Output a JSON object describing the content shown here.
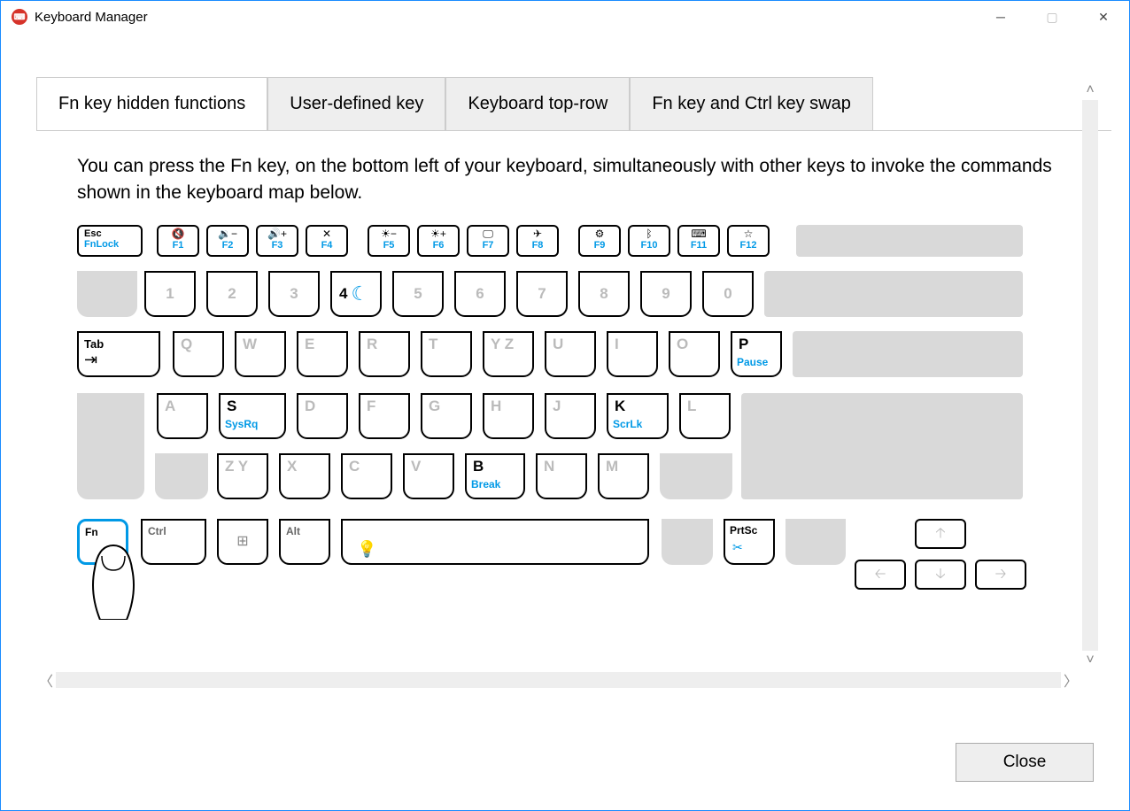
{
  "window": {
    "title": "Keyboard Manager"
  },
  "tabs": [
    {
      "label": "Fn key hidden functions"
    },
    {
      "label": "User-defined key"
    },
    {
      "label": "Keyboard top-row"
    },
    {
      "label": "Fn key and Ctrl key swap"
    }
  ],
  "description": "You can press the Fn key, on the bottom left of your keyboard, simultaneously with other keys to invoke the commands shown in the keyboard map below.",
  "close_label": "Close",
  "frow": [
    {
      "top": "Esc",
      "bot": "FnLock",
      "icon": ""
    },
    {
      "icon": "🔇",
      "bot": "F1"
    },
    {
      "icon": "🔉−",
      "bot": "F2"
    },
    {
      "icon": "🔊+",
      "bot": "F3"
    },
    {
      "icon": "✕",
      "bot": "F4"
    },
    {
      "icon": "☀−",
      "bot": "F5"
    },
    {
      "icon": "☀+",
      "bot": "F6"
    },
    {
      "icon": "🖵",
      "bot": "F7"
    },
    {
      "icon": "✈",
      "bot": "F8"
    },
    {
      "icon": "⚙",
      "bot": "F9"
    },
    {
      "icon": "ᛒ",
      "bot": "F10"
    },
    {
      "icon": "⌨",
      "bot": "F11"
    },
    {
      "icon": "☆",
      "bot": "F12"
    }
  ],
  "numrow": [
    "1",
    "2",
    "3",
    "4",
    "5",
    "6",
    "7",
    "8",
    "9",
    "0"
  ],
  "num4_icon": "☾",
  "qrow": [
    {
      "l": "Q"
    },
    {
      "l": "W"
    },
    {
      "l": "E"
    },
    {
      "l": "R"
    },
    {
      "l": "T"
    },
    {
      "l": "Y Z"
    },
    {
      "l": "U"
    },
    {
      "l": "I"
    },
    {
      "l": "O"
    },
    {
      "l": "P",
      "black": true,
      "sub": "Pause"
    }
  ],
  "tab_label": "Tab",
  "tab_icon": "⇥",
  "arow": [
    {
      "l": "A"
    },
    {
      "l": "S",
      "black": true,
      "sub": "SysRq"
    },
    {
      "l": "D"
    },
    {
      "l": "F"
    },
    {
      "l": "G"
    },
    {
      "l": "H"
    },
    {
      "l": "J"
    },
    {
      "l": "K",
      "black": true,
      "sub": "ScrLk"
    },
    {
      "l": "L"
    }
  ],
  "zrow": [
    {
      "l": "Z Y"
    },
    {
      "l": "X"
    },
    {
      "l": "C"
    },
    {
      "l": "V"
    },
    {
      "l": "B",
      "black": true,
      "sub": "Break"
    },
    {
      "l": "N"
    },
    {
      "l": "M"
    }
  ],
  "mods": {
    "fn": "Fn",
    "ctrl": "Ctrl",
    "alt": "Alt",
    "prtsc": "PrtSc",
    "space_icon": "💡"
  },
  "arrows": {
    "up": "🡡",
    "down": "🡣",
    "left": "🡠",
    "right": "🡢"
  }
}
